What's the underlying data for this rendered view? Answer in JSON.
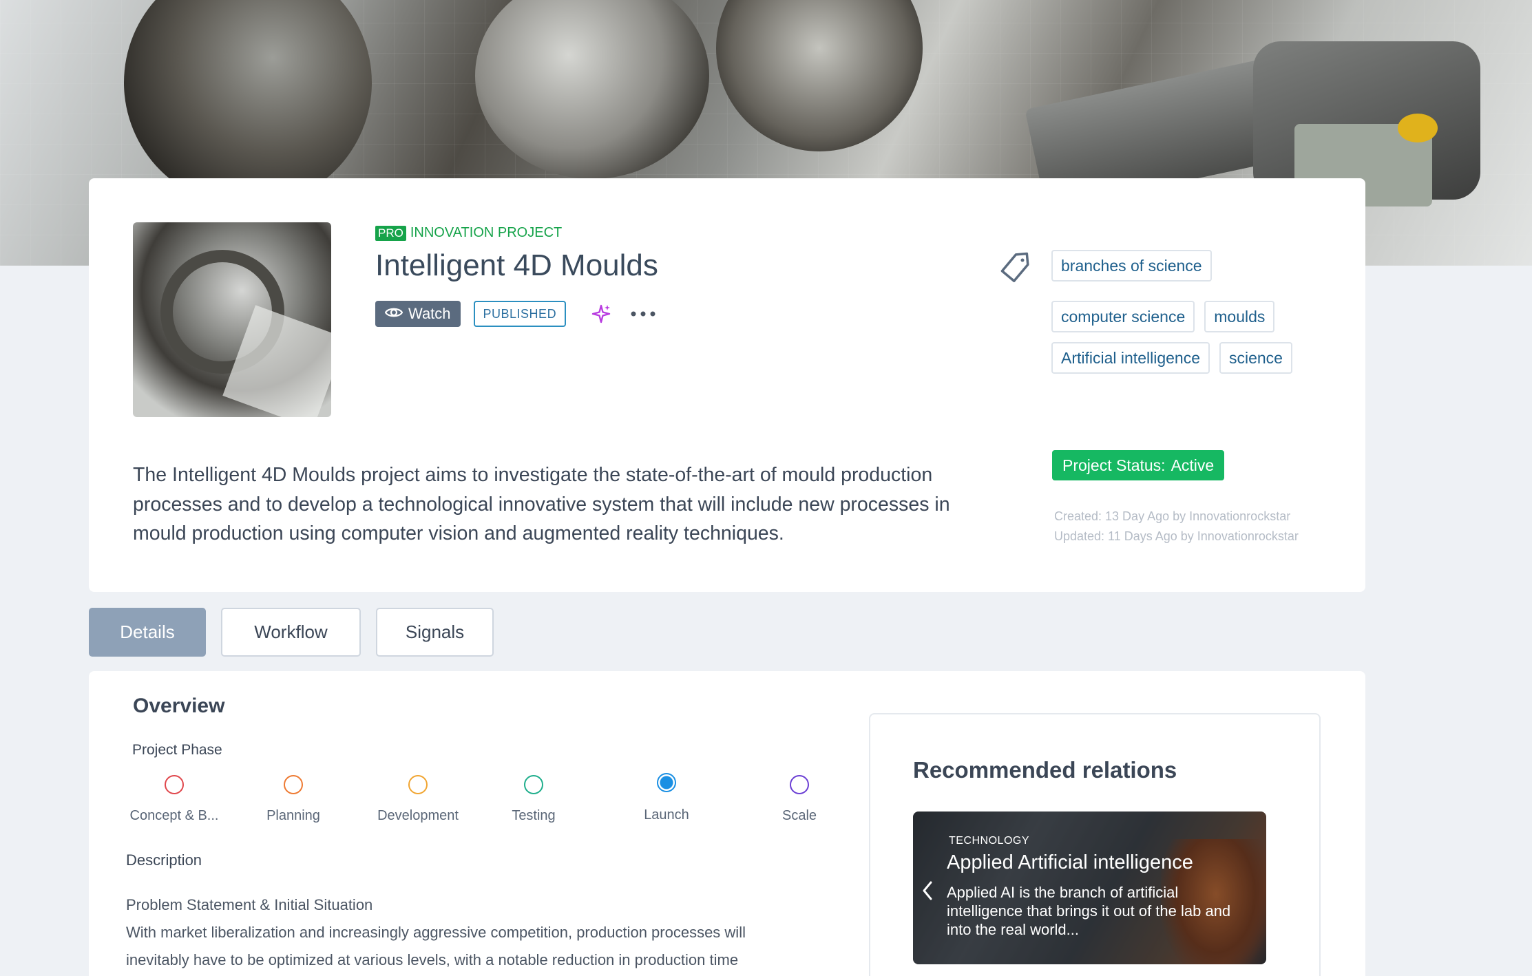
{
  "project": {
    "pro_badge": "PRO",
    "kicker": "INNOVATION PROJECT",
    "title": "Intelligent 4D Moulds",
    "watch_label": "Watch",
    "status_badge": "PUBLISHED",
    "summary": "The Intelligent 4D Moulds project aims to investigate the state-of-the-art of mould production processes and to develop a technological innovative system that will include new processes in mould production using computer vision and augmented reality techniques.",
    "project_status_label": "Project Status:",
    "project_status_value": "Active",
    "created": "Created: 13 Day Ago by Innovationrockstar",
    "updated": "Updated: 11 Days Ago by Innovationrockstar",
    "tags": [
      "branches of science",
      "computer science",
      "moulds",
      "Artificial intelligence",
      "science"
    ]
  },
  "tabs": [
    {
      "label": "Details",
      "active": true
    },
    {
      "label": "Workflow",
      "active": false
    },
    {
      "label": "Signals",
      "active": false
    }
  ],
  "overview": {
    "title": "Overview",
    "phase_label": "Project Phase",
    "phases": [
      {
        "label": "Concept & B...",
        "color": "#e0474c",
        "selected": false
      },
      {
        "label": "Planning",
        "color": "#ee7a32",
        "selected": false
      },
      {
        "label": "Development",
        "color": "#f1a531",
        "selected": false
      },
      {
        "label": "Testing",
        "color": "#1fae8c",
        "selected": false
      },
      {
        "label": "Launch",
        "color": "#1a8fe3",
        "selected": true
      },
      {
        "label": "Scale",
        "color": "#6b3fd4",
        "selected": false
      }
    ],
    "description_heading": "Description",
    "description_lines": [
      "Problem Statement & Initial Situation",
      "With market liberalization and increasingly aggressive competition, production processes will",
      "inevitably have to be optimized at various levels, with a notable reduction in production time"
    ]
  },
  "recommended": {
    "title": "Recommended relations",
    "card": {
      "category": "TECHNOLOGY",
      "name": "Applied Artificial intelligence",
      "text": "Applied AI is the branch of artificial intelligence that brings it out of the lab and into the real world..."
    }
  },
  "colors": {
    "accent_green": "#16a34a",
    "status_green": "#16b862",
    "published_blue": "#2b8fc0",
    "tab_active": "#8ea1b7"
  },
  "icons": [
    "eye-icon",
    "sparkle-icon",
    "more-dots-icon",
    "tag-icon",
    "chevron-left-icon"
  ]
}
